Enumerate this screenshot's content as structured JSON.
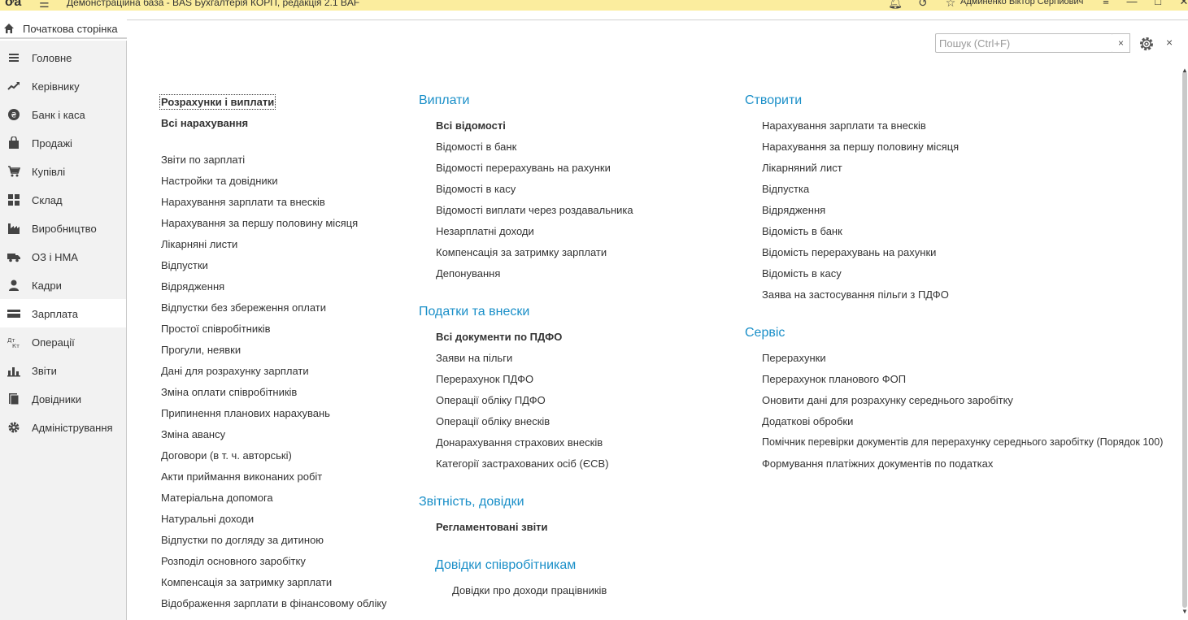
{
  "window": {
    "title": "Демонстраційна база - BAS Бухгалтерія КОРП, редакція 2.1 BAF",
    "user": "Админенко Віктор Сергійович"
  },
  "home_tab": {
    "label": "Початкова сторінка"
  },
  "sidebar": {
    "items": [
      {
        "label": "Головне",
        "icon": "menu-lines-icon"
      },
      {
        "label": "Керівнику",
        "icon": "trend-chart-icon"
      },
      {
        "label": "Банк і каса",
        "icon": "coin-icon"
      },
      {
        "label": "Продажі",
        "icon": "shopping-bag-icon"
      },
      {
        "label": "Купівлі",
        "icon": "cart-icon"
      },
      {
        "label": "Склад",
        "icon": "grid-boxes-icon"
      },
      {
        "label": "Виробництво",
        "icon": "factory-icon"
      },
      {
        "label": "ОЗ і НМА",
        "icon": "truck-icon"
      },
      {
        "label": "Кадри",
        "icon": "person-icon"
      },
      {
        "label": "Зарплата",
        "icon": "wallet-icon",
        "active": true
      },
      {
        "label": "Операції",
        "icon": "dt-kt-icon"
      },
      {
        "label": "Звіти",
        "icon": "bar-chart-icon"
      },
      {
        "label": "Довідники",
        "icon": "books-icon"
      },
      {
        "label": "Адміністрування",
        "icon": "gear-icon"
      }
    ]
  },
  "search": {
    "placeholder": "Пошук (Ctrl+F)",
    "clear": "×"
  },
  "close_label": "×",
  "col1": {
    "top": [
      "Розрахунки і виплати",
      "Всі нарахування"
    ],
    "links": [
      "Звіти по зарплаті",
      "Настройки та довідники",
      "Нарахування зарплати та внесків",
      "Нарахування за першу половину місяця",
      "Лікарняні листи",
      "Відпустки",
      "Відрядження",
      "Відпустки без збереження оплати",
      "Простої співробітників",
      "Прогули, неявки",
      "Дані для розрахунку зарплати",
      "Зміна оплати співробітників",
      "Припинення планових нарахувань",
      "Зміна авансу",
      "Договори (в т. ч. авторські)",
      "Акти приймання виконаних робіт",
      "Матеріальна допомога",
      "Натуральні доходи",
      "Відпустки по догляду за дитиною",
      "Розподіл основного заробітку",
      "Компенсація за затримку зарплати",
      "Відображення зарплати в фінансовому обліку"
    ]
  },
  "col2": {
    "payments": {
      "title": "Виплати",
      "bold": "Всі відомості",
      "links": [
        "Відомості в банк",
        "Відомості перерахувань на рахунки",
        "Відомості в касу",
        "Відомості виплати через роздавальника",
        "Незарплатні доходи",
        "Компенсація за затримку зарплати",
        "Депонування"
      ]
    },
    "taxes": {
      "title": "Податки та внески",
      "bold": "Всі документи по ПДФО",
      "links": [
        "Заяви на пільги",
        "Перерахунок ПДФО",
        "Операції обліку ПДФО",
        "Операції обліку внесків",
        "Донарахування страхових внесків",
        "Категорії застрахованих осіб (ЄСВ)"
      ]
    },
    "reporting": {
      "title": "Звітність, довідки",
      "bold": "Регламентовані звіти"
    },
    "certificates": {
      "title": "Довідки співробітникам",
      "links": [
        "Довідки про доходи працівників"
      ]
    }
  },
  "col3": {
    "create": {
      "title": "Створити",
      "links": [
        "Нарахування зарплати та внесків",
        "Нарахування за першу половину місяця",
        "Лікарняний лист",
        "Відпустка",
        "Відрядження",
        "Відомість в банк",
        "Відомість перерахувань на рахунки",
        "Відомість в касу",
        "Заява на застосування пільги з ПДФО"
      ]
    },
    "service": {
      "title": "Сервіс",
      "links": [
        "Перерахунки",
        "Перерахунок планового ФОП",
        "Оновити дані для розрахунку середнього заробітку",
        "Додаткові обробки",
        "Помічник перевірки документів для перерахунку середнього заробітку (Порядок 100)",
        "Формування платіжних документів по податках"
      ]
    }
  }
}
